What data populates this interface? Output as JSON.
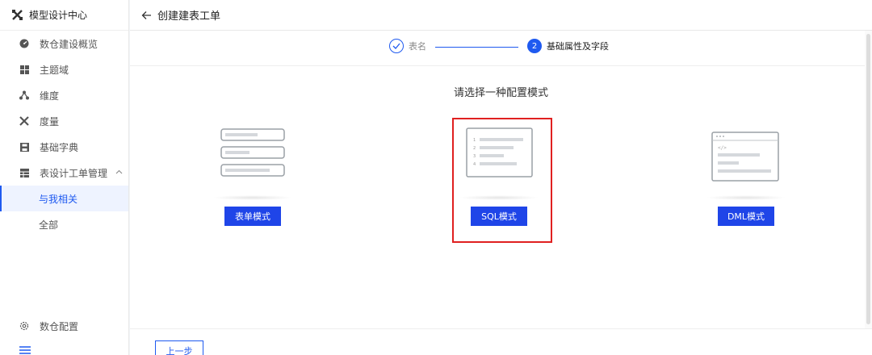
{
  "sidebar": {
    "brand": "模型设计中心",
    "items": [
      {
        "label": "数仓建设概览",
        "icon": "dashboard-icon"
      },
      {
        "label": "主题域",
        "icon": "grid-icon"
      },
      {
        "label": "维度",
        "icon": "hierarchy-icon"
      },
      {
        "label": "度量",
        "icon": "tools-icon"
      },
      {
        "label": "基础字典",
        "icon": "save-icon"
      },
      {
        "label": "表设计工单管理",
        "icon": "table-icon"
      }
    ],
    "sub_items": [
      {
        "label": "与我相关"
      },
      {
        "label": "全部"
      }
    ],
    "bottom": {
      "label": "数仓配置",
      "icon": "gear-icon"
    }
  },
  "header": {
    "title": "创建建表工单"
  },
  "steps": [
    {
      "label": "表名"
    },
    {
      "number": "2",
      "label": "基础属性及字段"
    }
  ],
  "main": {
    "prompt": "请选择一种配置模式",
    "options": [
      {
        "button": "表单模式"
      },
      {
        "button": "SQL模式",
        "lines": [
          "1",
          "2",
          "3",
          "4"
        ]
      },
      {
        "button": "DML模式",
        "code": "</>"
      }
    ]
  },
  "footer": {
    "prev": "上一步"
  },
  "colors": {
    "primary": "#1f45e8",
    "accent": "#1f5af0",
    "highlight": "#e02020"
  }
}
